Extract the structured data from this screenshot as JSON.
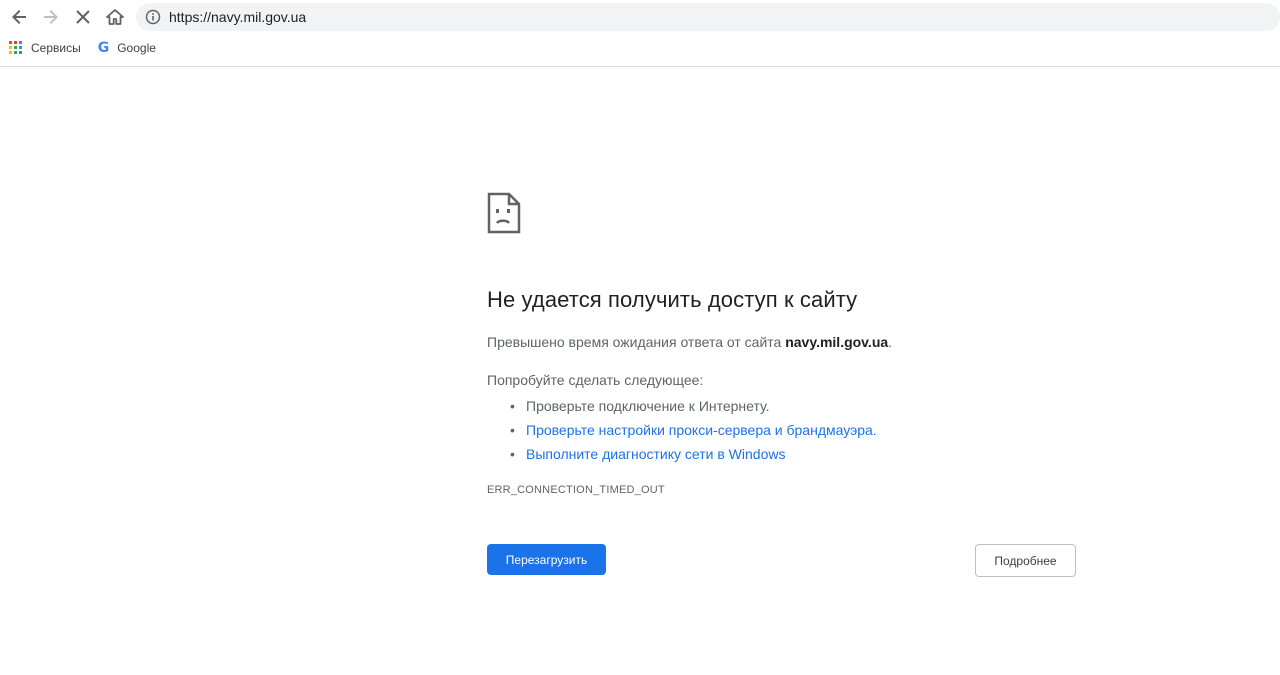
{
  "browser": {
    "url": "https://navy.mil.gov.ua",
    "icons": [
      "back-arrow-icon",
      "forward-arrow-icon",
      "stop-loading-icon",
      "home-icon",
      "info-icon"
    ],
    "bookmarks": [
      {
        "label": "Сервисы",
        "icon": "apps-grid-icon"
      },
      {
        "label": "Google",
        "icon": "google-g-icon"
      }
    ]
  },
  "error": {
    "icon": "sad-page-icon",
    "title": "Не удается получить доступ к сайту",
    "description_prefix": "Превышено время ожидания ответа от сайта",
    "description_host": "navy.mil.gov.ua",
    "description_suffix": ".",
    "suggestions_heading": "Попробуйте сделать следующее:",
    "suggestions": [
      "Проверьте подключение к Интернету.",
      "Проверьте настройки прокси-сервера и брандмауэра.",
      "Выполните диагностику сети в Windows"
    ],
    "code": "ERR_CONNECTION_TIMED_OUT",
    "reload_label": "Перезагрузить",
    "details_label": "Подробнее"
  },
  "colors": {
    "primary_button": "#1a73e8",
    "link": "#1a73e8",
    "text_secondary": "#5f6368",
    "omnibox_bg": "#f1f3f4"
  }
}
